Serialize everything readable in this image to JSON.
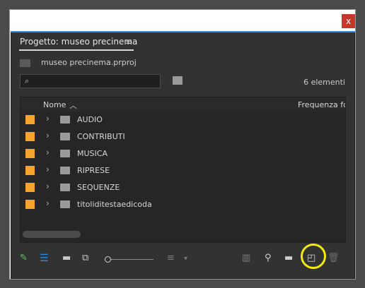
{
  "window": {
    "close_label": "x"
  },
  "panel": {
    "title": "Progetto: museo precinema",
    "menu_icon": "≡"
  },
  "project": {
    "file": "museo precinema.prproj"
  },
  "search": {
    "placeholder": ""
  },
  "count": "6 elementi",
  "list": {
    "columns": {
      "name": "Nome",
      "sort_arrow": "︿",
      "frame_rate": "Frequenza fot"
    },
    "rows": [
      {
        "label": "AUDIO"
      },
      {
        "label": "CONTRIBUTI"
      },
      {
        "label": "MUSICA"
      },
      {
        "label": "RIPRESE"
      },
      {
        "label": "SEQUENZE"
      },
      {
        "label": "titoliditestaedicoda"
      }
    ]
  },
  "toolbar": {
    "icons": [
      "pencil-icon",
      "list-view-icon",
      "icon-view-icon",
      "freeform-view-icon",
      "zoom-slider",
      "sort-icons",
      "automate-to-sequence-icon",
      "find-icon",
      "new-bin-icon",
      "new-item-icon",
      "clear-icon"
    ]
  },
  "colors": {
    "folder_label": "#f5a42e",
    "accent": "#2d8ceb",
    "highlight": "#f4e90e"
  }
}
